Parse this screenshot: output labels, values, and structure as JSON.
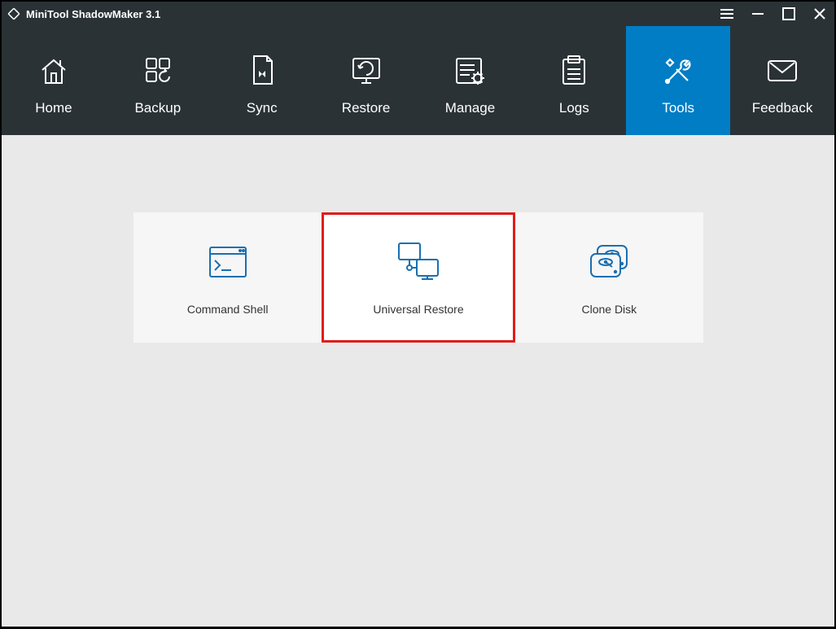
{
  "window": {
    "title": "MiniTool ShadowMaker 3.1"
  },
  "nav": {
    "items": [
      {
        "label": "Home"
      },
      {
        "label": "Backup"
      },
      {
        "label": "Sync"
      },
      {
        "label": "Restore"
      },
      {
        "label": "Manage"
      },
      {
        "label": "Logs"
      },
      {
        "label": "Tools"
      },
      {
        "label": "Feedback"
      }
    ],
    "active_index": 6
  },
  "tools": {
    "cards": [
      {
        "label": "Command Shell"
      },
      {
        "label": "Universal Restore"
      },
      {
        "label": "Clone Disk"
      }
    ],
    "highlighted_index": 1
  },
  "colors": {
    "accent": "#007dc5",
    "icon": "#1a6fb0",
    "highlight": "#e11b1b"
  }
}
